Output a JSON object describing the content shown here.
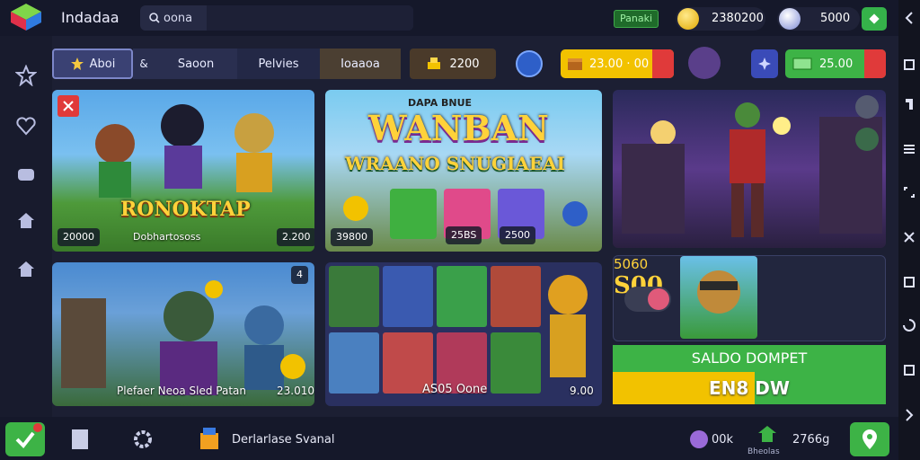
{
  "app": {
    "title": "Indadaa"
  },
  "search": {
    "text": "oona"
  },
  "topbar": {
    "panel_label": "Panaki",
    "coins": "2380200",
    "gems": "5000"
  },
  "tabs": [
    {
      "label": "Aboi",
      "active": true
    },
    {
      "label": "Saoon"
    },
    {
      "label": "Pelvies"
    },
    {
      "label": "Ioaaoa"
    }
  ],
  "tab_amount": "2200",
  "rewards": [
    {
      "value": "23.00 · 00"
    },
    {
      "value": "25.00"
    }
  ],
  "cards": {
    "card1": {
      "banner": "RONOKTAP",
      "price": "20000",
      "subtitle": "Dobhartososs",
      "badge": "2.200"
    },
    "card2": {
      "eyebrow": "DAPA BNUE",
      "title": "WANBAN",
      "subtitle": "WRAANO SNUGIAEAI",
      "price": "39800",
      "badge1": "25BS",
      "badge2": "2500"
    },
    "card3": {},
    "card4": {
      "caption": "Plefaer Neoa Sled Patan",
      "price": "23.010"
    },
    "card5": {
      "caption": "AS05 Oone",
      "price": "9.00"
    },
    "offer": {
      "line1": "5060",
      "line2": "S00"
    }
  },
  "saldo": {
    "title": "SALDO DOMPET",
    "value": "EN8 DW"
  },
  "bottombar": {
    "label_main": "Derlarlase Svanal",
    "stat1": "00k",
    "stat2": "2766g",
    "stat2_sub": "Bheolas"
  },
  "colors": {
    "bg": "#1c1f33",
    "green": "#3db346",
    "gold": "#f2c200",
    "tab": "#2a2f50"
  }
}
